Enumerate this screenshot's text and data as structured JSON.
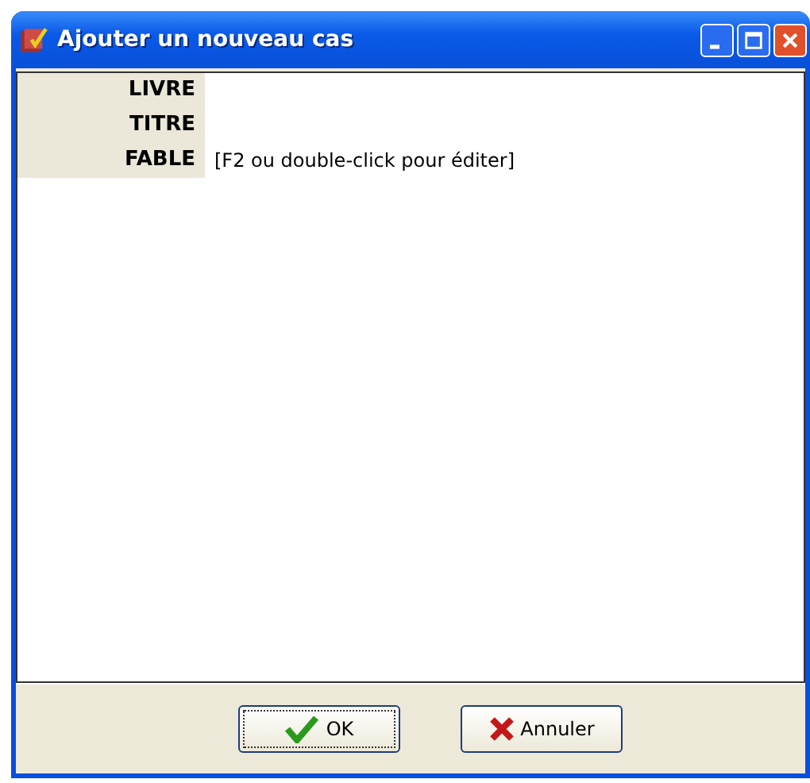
{
  "window": {
    "title": "Ajouter un nouveau cas"
  },
  "fields": [
    {
      "label": "LIVRE"
    },
    {
      "label": "TITRE"
    },
    {
      "label": "FABLE",
      "placeholder": "[F2 ou double-click pour éditer]"
    }
  ],
  "buttons": [
    {
      "label": "OK",
      "kind": "ok",
      "focused": true
    },
    {
      "label": "Annuler",
      "kind": "cancel",
      "focused": false
    }
  ]
}
